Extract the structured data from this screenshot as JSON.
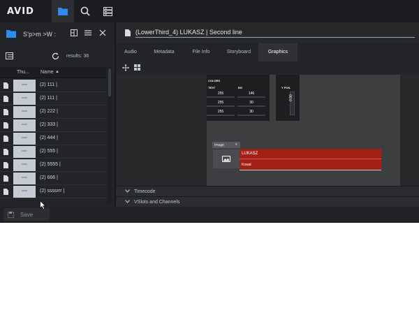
{
  "topbar": {
    "logo_text": "AVID",
    "buttons": [
      {
        "name": "browse",
        "icon": "folder-icon",
        "active": true
      },
      {
        "name": "search",
        "icon": "search-icon",
        "active": false
      },
      {
        "name": "panels",
        "icon": "panels-icon",
        "active": false
      }
    ]
  },
  "left_panel": {
    "title": "S’p>m >W :",
    "results_text": "results: 36",
    "columns": {
      "thumbnail": "Thu...",
      "name": "Name",
      "sort_indicator": "▲"
    },
    "items": [
      {
        "name": "(2) 111 |"
      },
      {
        "name": "(2) 111 |"
      },
      {
        "name": "(2) 222 |"
      },
      {
        "name": "(2) 333 |"
      },
      {
        "name": "(2) 444 |"
      },
      {
        "name": "(2) 555 |"
      },
      {
        "name": "(2) 5555 |"
      },
      {
        "name": "(2) 666 |"
      },
      {
        "name": "(2) ssssrrr |"
      }
    ]
  },
  "footer": {
    "save_label": "Save"
  },
  "asset": {
    "title": "(LowerThird_4) LUKASZ | Second line"
  },
  "tabs": [
    {
      "label": "Audio",
      "active": false
    },
    {
      "label": "Metadata",
      "active": false
    },
    {
      "label": "File Info",
      "active": false
    },
    {
      "label": "Storyboard",
      "active": false
    },
    {
      "label": "Graphics",
      "active": true
    }
  ],
  "graphics": {
    "colors_title": "COLORS",
    "text_label": "TEXT",
    "bg_label": "BG",
    "text_values": [
      "255",
      "255",
      "255"
    ],
    "bg_values": [
      "146",
      "30",
      "30"
    ],
    "ypos_label": "Y POS.",
    "ypos_value": "0.00",
    "image_select": "Image",
    "lower_third_line1": "LUKASZ",
    "lower_third_line2": "Kowal",
    "lower_third_color": "#a32016"
  },
  "sections": [
    {
      "label": "Timecode"
    },
    {
      "label": "VSlots and Channels"
    }
  ],
  "colors": {
    "accent": "#2d8cf0",
    "background": "#25272b"
  }
}
